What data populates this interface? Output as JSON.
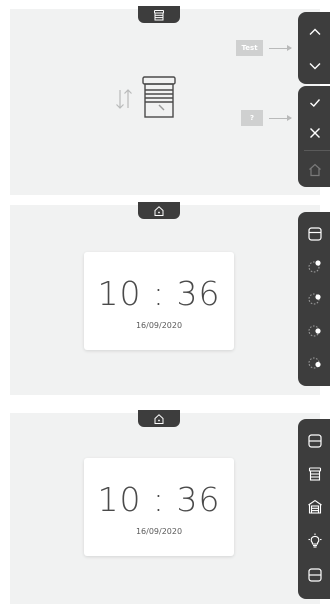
{
  "panel1": {
    "labels": {
      "test": "Test",
      "question": "?"
    },
    "icons": {
      "top": "blind-icon",
      "main": "blind-window-icon",
      "updown": "up-down-arrows-icon",
      "side": [
        "chevron-up-icon",
        "chevron-down-icon",
        "check-icon",
        "close-icon",
        "home-icon"
      ]
    }
  },
  "panel2": {
    "clock": {
      "time": "10 : 36",
      "date": "16/09/2020"
    },
    "icons": {
      "top": "home-icon",
      "side": [
        "blind-icon",
        "timer-icon",
        "timer-icon",
        "timer-icon",
        "timer-icon"
      ]
    }
  },
  "panel3": {
    "clock": {
      "time": "10 : 36",
      "date": "16/09/2020"
    },
    "icons": {
      "top": "home-icon",
      "side": [
        "blind-icon",
        "roller-shutter-icon",
        "garage-icon",
        "light-bulb-icon",
        "blind-icon"
      ]
    }
  },
  "colors": {
    "background": "#f1f2f2",
    "dark": "#3d3d3d",
    "label": "#cfd0d0",
    "accent_dot": "#ffffff"
  }
}
